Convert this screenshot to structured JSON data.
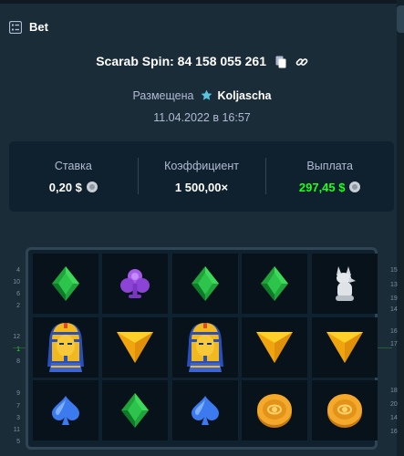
{
  "header": {
    "title": "Bet",
    "icon": "list-icon"
  },
  "bet": {
    "game_line": "Scarab Spin: 84 158 055 261",
    "placed_by_label": "Размещена",
    "user": "Koljascha",
    "date": "11.04.2022 в 16:57"
  },
  "stats": [
    {
      "label": "Ставка",
      "value": "0,20 $",
      "currency_icon": "coin-icon"
    },
    {
      "label": "Коэффициент",
      "value": "1 500,00×"
    },
    {
      "label": "Выплата",
      "value": "297,45 $",
      "currency_icon": "coin-icon",
      "color": "#1fff20"
    }
  ],
  "reels": {
    "rows": [
      [
        "green-diamond",
        "purple-club",
        "green-diamond",
        "green-diamond",
        "anubis-statue"
      ],
      [
        "pharaoh-mask",
        "yellow-triangle",
        "pharaoh-mask",
        "yellow-triangle",
        "yellow-triangle"
      ],
      [
        "blue-spade",
        "green-diamond",
        "blue-spade",
        "gold-coin",
        "gold-coin"
      ]
    ]
  },
  "line_numbers": {
    "left": [
      "4",
      "10",
      "6",
      "2",
      "12",
      "1",
      "8",
      "9",
      "7",
      "3",
      "11",
      "5"
    ],
    "right": [
      "15",
      "13",
      "19",
      "14",
      "16",
      "17",
      "18",
      "20",
      "14",
      "16"
    ]
  },
  "colors": {
    "background": "#1a2c38",
    "panel": "#0f212e",
    "green": "#1fff20",
    "muted": "#b1bad3"
  }
}
